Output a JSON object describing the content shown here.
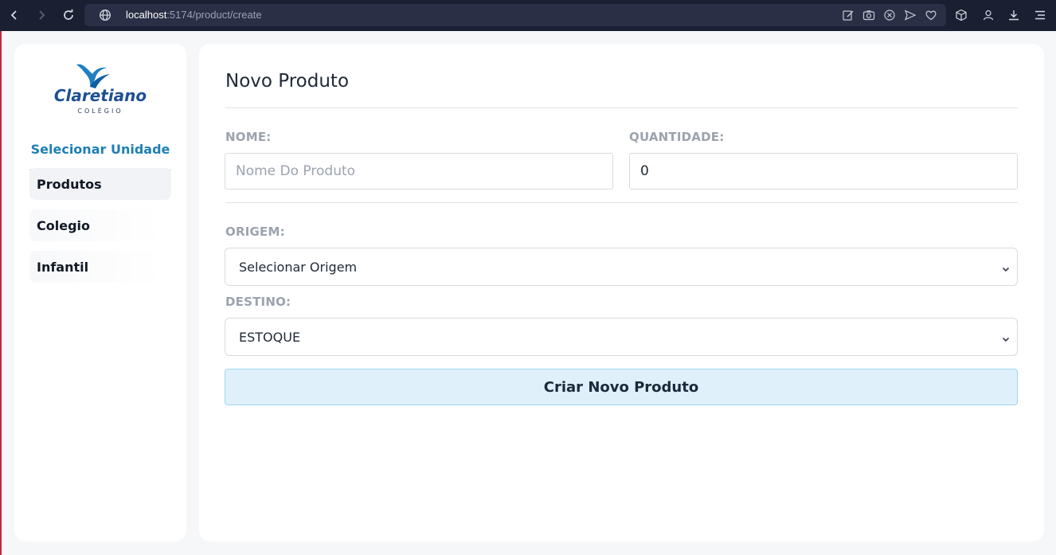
{
  "browser": {
    "url_host": "localhost",
    "url_path": ":5174/product/create",
    "icons": [
      "back-icon",
      "forward-icon",
      "reload-icon",
      "site-info-icon",
      "edit-icon",
      "camera-icon",
      "close-circle-icon",
      "send-icon",
      "heart-icon",
      "box-icon",
      "profile-icon",
      "download-icon",
      "menu-icon"
    ]
  },
  "sidebar": {
    "logo_name": "Claretiano",
    "logo_sub": "COLÉGIO",
    "unit_link": "Selecionar Unidade",
    "items": [
      {
        "label": "Produtos",
        "active": true
      },
      {
        "label": "Colegio",
        "active": false
      },
      {
        "label": "Infantil",
        "active": false
      }
    ]
  },
  "form": {
    "title": "Novo Produto",
    "name_label": "NOME:",
    "name_placeholder": "Nome Do Produto",
    "name_value": "",
    "qty_label": "QUANTIDADE:",
    "qty_value": "0",
    "origin_label": "ORIGEM:",
    "origin_selected": "Selecionar Origem",
    "dest_label": "DESTINO:",
    "dest_selected": "ESTOQUE",
    "submit_label": "Criar Novo Produto"
  },
  "colors": {
    "accent": "#1e7fb4",
    "button_bg": "#dff0fb",
    "button_border": "#9fd6ee",
    "chrome_bg": "#1b1f32"
  }
}
